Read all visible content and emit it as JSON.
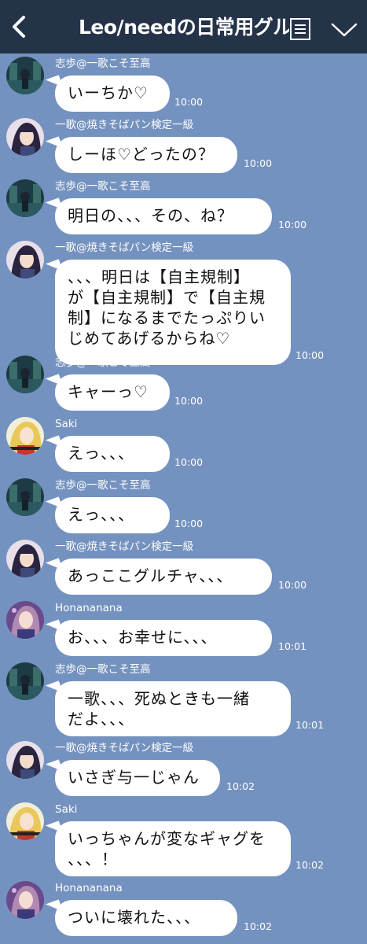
{
  "header": {
    "title": "Leo/needの日常用グル",
    "back_icon": "chevron-left-icon",
    "menu_icon": "menu-icon",
    "expand_icon": "chevron-down-icon",
    "background": "#243348"
  },
  "chat": {
    "background": "#7492bf",
    "messages": [
      {
        "sender": "志歩@一歌こそ至高",
        "text": "いーちか♡",
        "time": "10:00",
        "avatar": "shiho"
      },
      {
        "sender": "一歌@焼きそばパン検定一級",
        "text": "しーほ♡どったの？",
        "time": "10:00",
        "avatar": "ichika"
      },
      {
        "sender": "志歩@一歌こそ至高",
        "text": "明日の、、、その、ね？",
        "time": "10:00",
        "avatar": "shiho"
      },
      {
        "sender": "一歌@焼きそばパン検定一級",
        "text": "、、、明日は【自主規制】\nが【自主規制】で【自主規\n制】になるまでたっぷりい\nじめてあげるからね♡",
        "time": "10:00",
        "avatar": "ichika"
      },
      {
        "sender": "志歩@一歌こそ至高",
        "text": "キャーっ♡",
        "time": "10:00",
        "avatar": "shiho"
      },
      {
        "sender": "Saki",
        "text": "えっ、、、",
        "time": "10:00",
        "avatar": "saki"
      },
      {
        "sender": "志歩@一歌こそ至高",
        "text": "えっ、、、",
        "time": "10:00",
        "avatar": "shiho"
      },
      {
        "sender": "一歌@焼きそばパン検定一級",
        "text": "あっここグルチャ、、、",
        "time": "10:00",
        "avatar": "ichika"
      },
      {
        "sender": "Honananana",
        "text": "お、、、お幸せに、、、",
        "time": "10:01",
        "avatar": "honami"
      },
      {
        "sender": "志歩@一歌こそ至高",
        "text": "一歌、、、死ぬときも一緒\nだよ、、、",
        "time": "10:01",
        "avatar": "shiho"
      },
      {
        "sender": "一歌@焼きそばパン検定一級",
        "text": "いさぎ与一じゃん",
        "time": "10:02",
        "avatar": "ichika"
      },
      {
        "sender": "Saki",
        "text": "いっちゃんが変なギャグを\n、、、！",
        "time": "10:02",
        "avatar": "saki"
      },
      {
        "sender": "Honananana",
        "text": "ついに壊れた、、、",
        "time": "10:02",
        "avatar": "honami"
      }
    ]
  }
}
